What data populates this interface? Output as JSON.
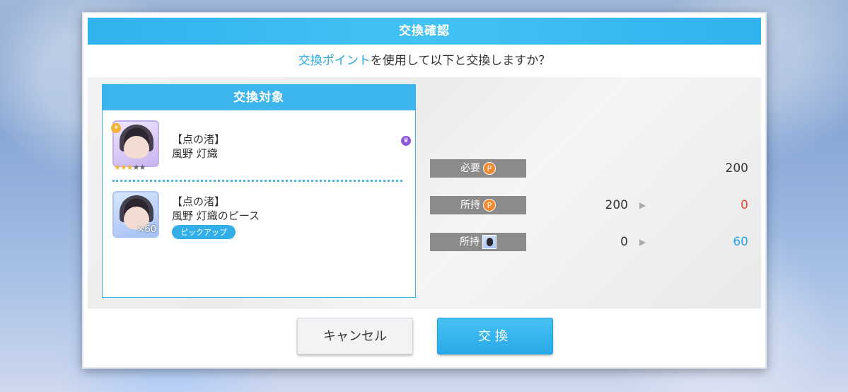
{
  "dialog": {
    "title": "交換確認",
    "question_highlight": "交換ポイント",
    "question_rest": "を使用して以下と交換しますか？"
  },
  "target": {
    "header": "交換対象",
    "items": [
      {
        "line1": "【点の渚】",
        "line2": "風野 灯織",
        "stars_filled": 3,
        "stars_total": 5
      },
      {
        "line1": "【点の渚】",
        "line2": "風野 灯織のピース",
        "count": "×60",
        "tag": "ピックアップ"
      }
    ]
  },
  "costs": {
    "required": {
      "label": "必要",
      "icon": "P",
      "value": "200"
    },
    "owned_points": {
      "label": "所持",
      "icon": "P",
      "before": "200",
      "after": "0",
      "after_color": "#e8492c"
    },
    "owned_pieces": {
      "label": "所持",
      "before": "0",
      "after": "60",
      "after_color": "#2aa6e6"
    }
  },
  "buttons": {
    "cancel": "キャンセル",
    "confirm": "交換"
  }
}
